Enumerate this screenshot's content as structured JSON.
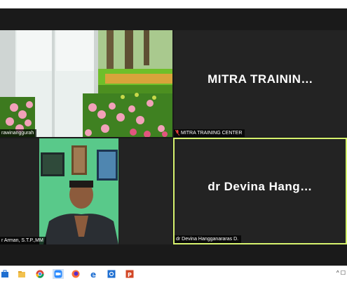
{
  "participants": [
    {
      "name": "rawinanggurah",
      "shows_video": true
    },
    {
      "name": "MITRA TRAINING CENTER",
      "display_title": "MITRA  TRAININ…",
      "mic_muted": true
    },
    {
      "name": "r Arman, S.T.P.,MM",
      "shows_video": true
    },
    {
      "name": "dr Devina Hangganararas D.",
      "display_title": "dr  Devina  Hang…",
      "active_speaker": true
    }
  ],
  "taskbar": {
    "icons": [
      "windows-store-icon",
      "file-explorer-icon",
      "chrome-icon",
      "zoom-icon",
      "firefox-icon",
      "edge-icon",
      "settings-icon",
      "powerpoint-icon"
    ],
    "tray_text": "^ ☐"
  },
  "colors": {
    "active_border": "#d6f26e",
    "mic_muted": "#e03b3b",
    "background": "#1a1a1a"
  }
}
